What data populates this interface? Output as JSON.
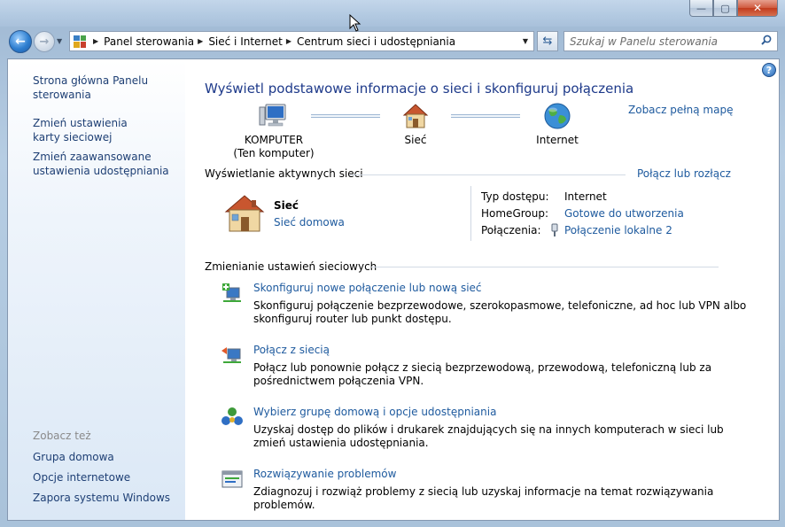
{
  "window": {
    "caption_buttons": {
      "minimize": "—",
      "maximize": "▢",
      "close": "✕"
    }
  },
  "navbar": {
    "breadcrumbs": [
      "Panel sterowania",
      "Sieć i Internet",
      "Centrum sieci i udostępniania"
    ],
    "search_placeholder": "Szukaj w Panelu sterowania"
  },
  "left_pane": {
    "links": [
      "Strona główna Panelu sterowania",
      "Zmień ustawienia karty sieciowej",
      "Zmień zaawansowane ustawienia udostępniania"
    ],
    "see_also_heading": "Zobacz też",
    "see_also": [
      "Grupa domowa",
      "Opcje internetowe",
      "Zapora systemu Windows"
    ]
  },
  "main": {
    "title": "Wyświetl podstawowe informacje o sieci i skonfiguruj połączenia",
    "full_map_link": "Zobacz pełną mapę",
    "map": {
      "computer_name": "KOMPUTER",
      "computer_sub": "(Ten komputer)",
      "network": "Sieć",
      "internet": "Internet"
    },
    "active_networks": {
      "heading": "Wyświetlanie aktywnych sieci",
      "connect_link": "Połącz lub rozłącz",
      "network_name": "Sieć",
      "network_type": "Sieć domowa",
      "props": [
        {
          "label": "Typ dostępu:",
          "value": "Internet"
        },
        {
          "label": "HomeGroup:",
          "value": "Gotowe do utworzenia"
        },
        {
          "label": "Połączenia:",
          "value": "Połączenie lokalne 2"
        }
      ]
    },
    "change_settings": {
      "heading": "Zmienianie ustawień sieciowych",
      "tasks": [
        {
          "title": "Skonfiguruj nowe połączenie lub nową sieć",
          "desc": "Skonfiguruj połączenie bezprzewodowe, szerokopasmowe, telefoniczne, ad hoc lub VPN albo skonfiguruj router lub punkt dostępu."
        },
        {
          "title": "Połącz z siecią",
          "desc": "Połącz lub ponownie połącz z siecią bezprzewodową, przewodową, telefoniczną lub za pośrednictwem połączenia VPN."
        },
        {
          "title": "Wybierz grupę domową i opcje udostępniania",
          "desc": "Uzyskaj dostęp do plików i drukarek znajdujących się na innych komputerach w sieci lub zmień ustawienia udostępniania."
        },
        {
          "title": "Rozwiązywanie problemów",
          "desc": "Zdiagnozuj i rozwiąż problemy z siecią lub uzyskaj informacje na temat rozwiązywania problemów."
        }
      ]
    }
  },
  "colors": {
    "link": "#1e5a9e",
    "title": "#1e3a8a",
    "left_link": "#1e3f74"
  }
}
